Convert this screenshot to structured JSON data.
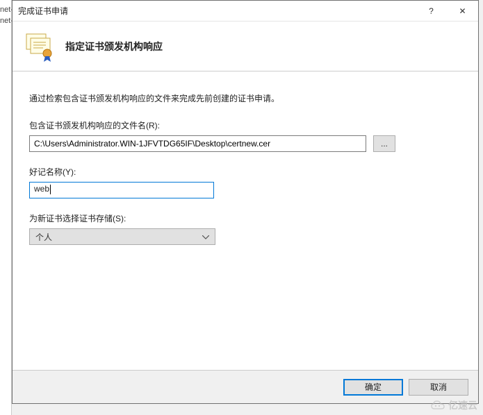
{
  "bg": {
    "line1": "net-",
    "line2": "net-"
  },
  "titlebar": {
    "title": "完成证书申请",
    "help": "?",
    "close": "✕"
  },
  "header": {
    "title": "指定证书颁发机构响应"
  },
  "body": {
    "description": "通过检索包含证书颁发机构响应的文件来完成先前创建的证书申请。",
    "file_label": "包含证书颁发机构响应的文件名(R):",
    "file_value": "C:\\Users\\Administrator.WIN-1JFVTDG65IF\\Desktop\\certnew.cer",
    "browse_label": "...",
    "name_label": "好记名称(Y):",
    "name_value": "web",
    "store_label": "为新证书选择证书存储(S):",
    "store_value": "个人"
  },
  "footer": {
    "ok": "确定",
    "cancel": "取消"
  },
  "watermark": "亿速云"
}
